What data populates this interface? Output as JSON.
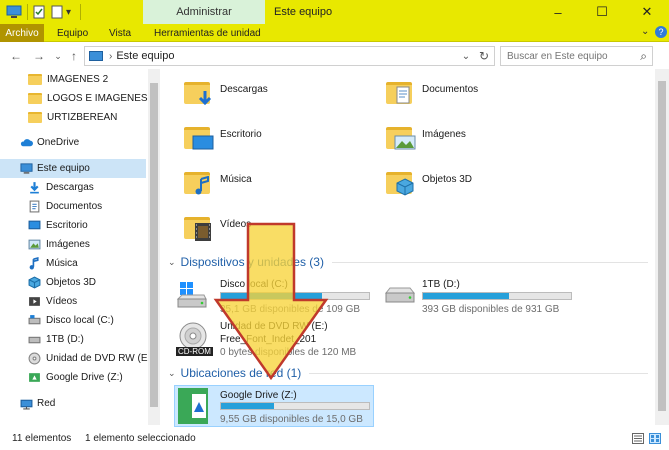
{
  "titlebar": {
    "contextual_tab": "Administrar",
    "window_title": "Este equipo",
    "minimize": "–",
    "maximize": "☐",
    "close": "✕"
  },
  "ribbon": {
    "tabs": [
      "Archivo",
      "Equipo",
      "Vista",
      "Herramientas de unidad"
    ],
    "expand": "⌄",
    "help": "?"
  },
  "addressbar": {
    "back": "←",
    "forward": "→",
    "recent": "⌄",
    "up": "↑",
    "path": "Este equipo",
    "dropdown": "⌄",
    "refresh": "↻",
    "search_placeholder": "Buscar en Este equipo"
  },
  "navpane": {
    "items": [
      {
        "label": "IMAGENES 2",
        "icon": "folder-icon"
      },
      {
        "label": "LOGOS E IMAGENES",
        "icon": "folder-icon"
      },
      {
        "label": "URTIZBEREAN",
        "icon": "folder-icon"
      },
      {
        "label": "OneDrive",
        "icon": "cloud-icon"
      },
      {
        "label": "Este equipo",
        "icon": "computer-icon"
      },
      {
        "label": "Descargas",
        "icon": "download-icon"
      },
      {
        "label": "Documentos",
        "icon": "document-icon"
      },
      {
        "label": "Escritorio",
        "icon": "desktop-icon"
      },
      {
        "label": "Imágenes",
        "icon": "pictures-icon"
      },
      {
        "label": "Música",
        "icon": "music-icon"
      },
      {
        "label": "Objetos 3D",
        "icon": "cube-icon"
      },
      {
        "label": "Vídeos",
        "icon": "video-icon"
      },
      {
        "label": "Disco local (C:)",
        "icon": "drive-icon"
      },
      {
        "label": "1TB (D:)",
        "icon": "drive-icon"
      },
      {
        "label": "Unidad de DVD RW (E:) F",
        "icon": "dvd-icon"
      },
      {
        "label": "Google Drive (Z:)",
        "icon": "network-drive-icon"
      },
      {
        "label": "Red",
        "icon": "network-icon"
      }
    ]
  },
  "folders": [
    {
      "label": "Descargas",
      "overlay": "download-icon"
    },
    {
      "label": "Documentos",
      "overlay": "document-icon"
    },
    {
      "label": "Escritorio",
      "overlay": "desktop-icon"
    },
    {
      "label": "Imágenes",
      "overlay": "pictures-icon"
    },
    {
      "label": "Música",
      "overlay": "music-icon"
    },
    {
      "label": "Objetos 3D",
      "overlay": "cube-icon"
    },
    {
      "label": "Vídeos",
      "overlay": "video-icon"
    }
  ],
  "groups": {
    "devices": "Dispositivos y unidades (3)",
    "network": "Ubicaciones de red (1)",
    "collapse": "⌄"
  },
  "drives": [
    {
      "name": "Disco local (C:)",
      "free": "35,1 GB disponibles de 109 GB",
      "used_fraction": 0.68
    },
    {
      "name": "1TB (D:)",
      "free": "393 GB disponibles de 931 GB",
      "used_fraction": 0.58
    },
    {
      "name": "Unidad de DVD RW (E:)",
      "label2": "Free_Font_Indet_201",
      "free": "0 bytes disponibles de 120 MB",
      "badge": "CD-ROM"
    },
    {
      "name": "Google Drive (Z:)",
      "free": "9,55 GB disponibles de 15,0 GB",
      "used_fraction": 0.36
    }
  ],
  "status": {
    "count": "11 elementos",
    "selected": "1 elemento seleccionado"
  },
  "colors": {
    "titlebar": "#e8e800",
    "accent": "#26a0da",
    "arrow_fill": "#f7d33a",
    "arrow_stroke": "#c0392b"
  }
}
